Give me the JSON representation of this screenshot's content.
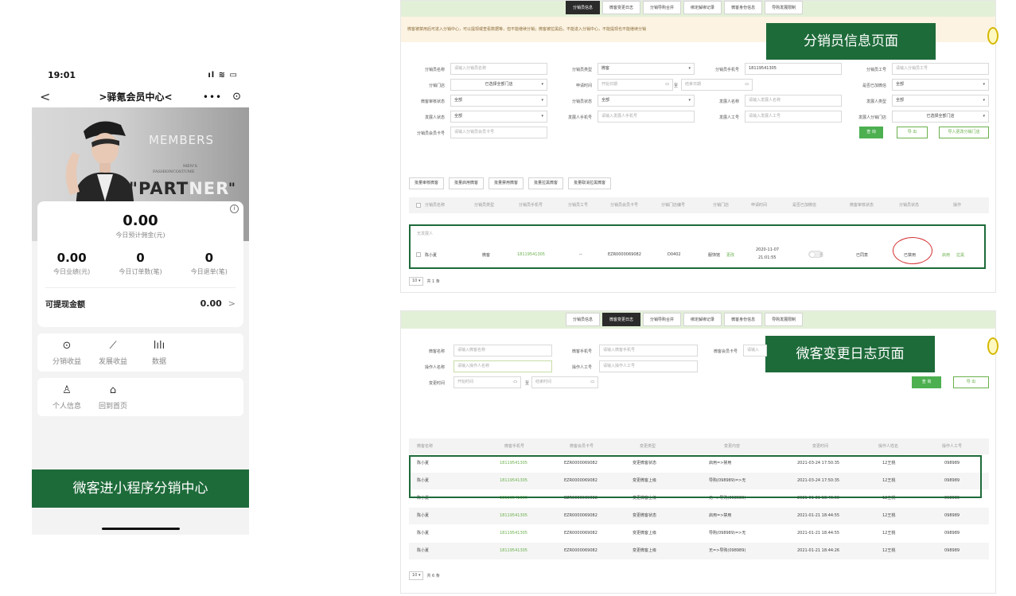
{
  "phone": {
    "time": "19:01",
    "status_icons": "ıl ≋ ▭",
    "nav": {
      "back": "<",
      "title": ">驿氪会员中心<",
      "more": "•••",
      "target": "⊙"
    },
    "banner": {
      "members": "MEMBERS",
      "mens": "MEN'S",
      "fashion": "FASHIONCOSTUME",
      "partner_a": "\"PART",
      "partner_b": "NER",
      "quote": "\""
    },
    "earnings": {
      "today_value": "0.00",
      "today_label": "今日预计佣金(元)",
      "stats": [
        {
          "value": "0.00",
          "label": "今日业绩(元)"
        },
        {
          "value": "0",
          "label": "今日订单数(笔)"
        },
        {
          "value": "0",
          "label": "今日退单(笔)"
        }
      ],
      "withdraw_label": "可提现金额",
      "withdraw_value": "0.00",
      "withdraw_arrow": ">"
    },
    "menu1": [
      {
        "icon": "⊙",
        "label": "分销收益"
      },
      {
        "icon": "⟋",
        "label": "发展收益"
      },
      {
        "icon": "lılı",
        "label": "数据"
      }
    ],
    "menu2": [
      {
        "icon": "♙",
        "label": "个人信息"
      },
      {
        "icon": "⌂",
        "label": "回到首页"
      }
    ],
    "caption": "微客进小程序分销中心"
  },
  "tabs": [
    "分销员信息",
    "微客变更日志",
    "分销导购合并",
    "绑定解绑记录",
    "微客身份信息",
    "导购发展限制"
  ],
  "panel1": {
    "notice": "微客被禁用后可进入分销中心，可以提现或查看数据等，但不能继续分销；微客被拉黑后，不能进入分销中心，不能提现也不能继续分销",
    "label": "分销员信息页面",
    "filters": {
      "distributor_name_label": "分销员名称",
      "distributor_name_ph": "请输入分销员名称",
      "distributor_type_label": "分销员类型",
      "distributor_type_val": "微客",
      "distributor_phone_label": "分销员手机号",
      "distributor_phone_val": "18119541305",
      "distributor_job_label": "分销员工号",
      "distributor_job_ph": "请输入分销员工号",
      "store_label": "分销门店",
      "store_val": "已选择全部门店",
      "apply_time_label": "申请时间",
      "start_ph": "开始日期",
      "to": "至",
      "end_ph": "结束日期",
      "wechat_label": "是否已加微信",
      "wechat_val": "全部",
      "audit_label": "微客审核状态",
      "audit_val": "全部",
      "dist_status_label": "分销员状态",
      "dist_status_val": "全部",
      "dev_name_label": "发展人名称",
      "dev_name_ph": "请输入发展人名称",
      "dev_type_label": "发展人类型",
      "dev_type_val": "全部",
      "dev_status_label": "发展人状态",
      "dev_status_val": "全部",
      "dev_phone_label": "发展人手机号",
      "dev_phone_ph": "请输入发展人手机号",
      "dev_job_label": "发展人工号",
      "dev_job_ph": "请输入发展人工号",
      "dev_store_label": "发展人分销门店",
      "dev_store_val": "已选择全部门店",
      "card_label": "分销员会员卡号",
      "card_ph": "请输入分销员会员卡号",
      "query": "查 询",
      "export": "导 出",
      "export_store": "导入更改分销门店"
    },
    "batch": [
      "批量审核微客",
      "批量启用微客",
      "批量禁用微客",
      "批量拉黑微客",
      "批量取消拉黑微客"
    ],
    "headers": [
      "分销员名称",
      "分销员类型",
      "分销员手机号",
      "分销员工号",
      "分销员会员卡号",
      "分销门店编号",
      "分销门店",
      "申请时间",
      "是否已加微信",
      "微客审核状态",
      "分销员状态",
      "操作"
    ],
    "group_label": "无发展人",
    "row": {
      "name": "陈小夏",
      "type": "微客",
      "phone": "18119541305",
      "job": "--",
      "card": "EZR0000069082",
      "store_code": "D0402",
      "store": "服饰馆",
      "store_change": "更改",
      "date": "2020-11-07",
      "time": "21:01:55",
      "toggle": "否",
      "audit": "已同意",
      "status": "已禁用",
      "op_enable": "启用",
      "op_block": "拉黑"
    },
    "pager": {
      "size": "10 ▾",
      "total": "共 1 条"
    }
  },
  "panel2": {
    "label": "微客变更日志页面",
    "filters": {
      "name_label": "微客名称",
      "name_ph": "请输入微客名称",
      "phone_label": "微客手机号",
      "phone_ph": "请输入微客手机号",
      "card_label": "微客会员卡号",
      "card_ph": "请输入",
      "op_name_label": "操作人名称",
      "op_name_ph": "请输入操作人名称",
      "op_job_label": "操作人工号",
      "op_job_ph": "请输入操作人工号",
      "time_label": "变更时间",
      "start_ph": "开始时间",
      "to": "至",
      "end_ph": "结束时间",
      "query": "查 询",
      "export": "导 出"
    },
    "headers": [
      "微客名称",
      "微客手机号",
      "微客会员卡号",
      "变更类型",
      "变更内容",
      "变更时间",
      "操作人姓名",
      "操作人工号"
    ],
    "rows": [
      {
        "name": "陈小夏",
        "phone": "18119541305",
        "card": "EZR0000069082",
        "type": "变更微客状态",
        "content": "启用=>禁用",
        "time": "2021-03-24 17:50:35",
        "op": "12王桃",
        "job": "098989"
      },
      {
        "name": "陈小夏",
        "phone": "18119541305",
        "card": "EZR0000069082",
        "type": "变更微客上级",
        "content": "导购(098989)=>无",
        "time": "2021-03-24 17:50:35",
        "op": "12王桃",
        "job": "098989"
      },
      {
        "name": "陈小夏",
        "phone": "18119541305",
        "card": "EZR0000069082",
        "type": "变更微客上级",
        "content": "无=>导购(098989)",
        "time": "2021-01-21 18:46:09",
        "op": "12王桃",
        "job": "098989"
      },
      {
        "name": "陈小夏",
        "phone": "18119541305",
        "card": "EZR0000069082",
        "type": "变更微客状态",
        "content": "启用=>禁用",
        "time": "2021-01-21 18:44:55",
        "op": "12王桃",
        "job": "098989"
      },
      {
        "name": "陈小夏",
        "phone": "18119541305",
        "card": "EZR0000069082",
        "type": "变更微客上级",
        "content": "导购(098989)=>无",
        "time": "2021-01-21 18:44:55",
        "op": "12王桃",
        "job": "098989"
      },
      {
        "name": "陈小夏",
        "phone": "18119541305",
        "card": "EZR0000069082",
        "type": "变更微客上级",
        "content": "无=>导购(098989)",
        "time": "2021-01-21 18:44:26",
        "op": "12王桃",
        "job": "098989"
      }
    ],
    "pager": {
      "size": "10 ▾",
      "total": "共 6 条"
    }
  },
  "colors": {
    "accent_green": "#1e6b3a",
    "light_green": "#6ab04c",
    "tab_bar": "#e3f0d8",
    "notice_bg": "#fcf3e2",
    "red_mark": "#d32f2f"
  }
}
